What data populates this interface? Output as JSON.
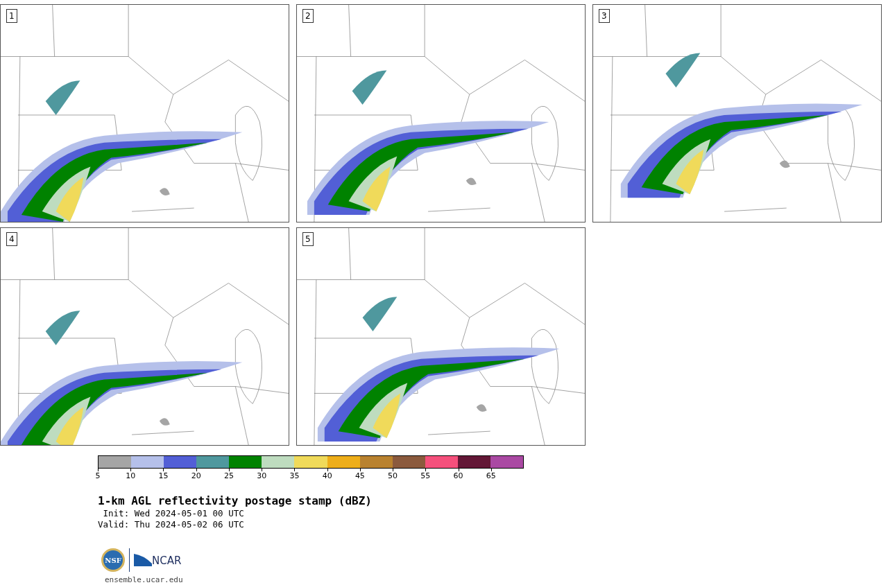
{
  "panels": [
    {
      "label": "1"
    },
    {
      "label": "2"
    },
    {
      "label": "3"
    },
    {
      "label": "4"
    },
    {
      "label": "5"
    }
  ],
  "colorbar": {
    "segments": [
      {
        "color": "#a5a5a5",
        "tick": "5"
      },
      {
        "color": "#b5c0ea",
        "tick": "10"
      },
      {
        "color": "#525fd6",
        "tick": "15"
      },
      {
        "color": "#4f989e",
        "tick": "20"
      },
      {
        "color": "#008200",
        "tick": "25"
      },
      {
        "color": "#bedcbf",
        "tick": "30"
      },
      {
        "color": "#f0da5a",
        "tick": "35"
      },
      {
        "color": "#eeae1a",
        "tick": "40"
      },
      {
        "color": "#b9822f",
        "tick": "45"
      },
      {
        "color": "#8b5a3d",
        "tick": "50"
      },
      {
        "color": "#f5507c",
        "tick": "55"
      },
      {
        "color": "#631736",
        "tick": "60"
      },
      {
        "color": "#aa49a3",
        "tick": "65"
      }
    ]
  },
  "title": "1-km AGL reflectivity postage stamp (dBZ)",
  "init": " Init: Wed 2024-05-01 00 UTC",
  "valid": "Valid: Thu 2024-05-02 06 UTC",
  "logos": {
    "nsf": "NSF",
    "ncar": "NCAR"
  },
  "url": "ensemble.ucar.edu"
}
